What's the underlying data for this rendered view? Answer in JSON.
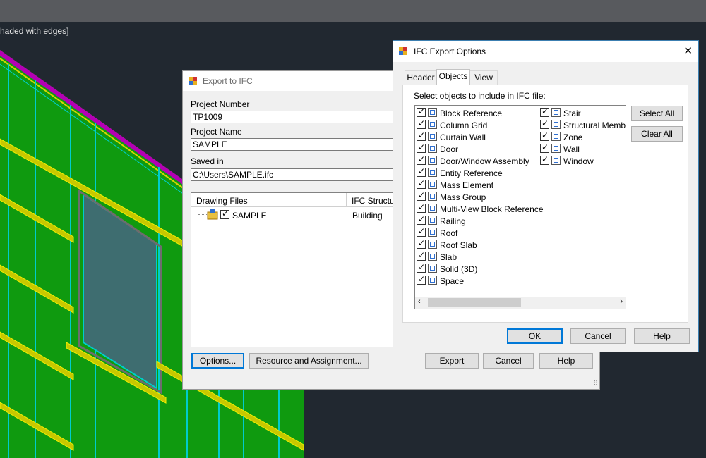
{
  "viewport": {
    "label": "haded with edges]"
  },
  "export_dialog": {
    "title": "Export to IFC",
    "project_number_label": "Project Number",
    "project_number_value": "TP1009",
    "project_name_label": "Project Name",
    "project_name_value": "SAMPLE",
    "saved_in_label": "Saved in",
    "saved_in_value": "C:\\Users\\SAMPLE.ifc",
    "columns": [
      "Drawing Files",
      "IFC Structur"
    ],
    "rows": [
      {
        "name": "SAMPLE",
        "structure": "Building"
      }
    ],
    "buttons": {
      "options": "Options...",
      "resource": "Resource and Assignment...",
      "export": "Export",
      "cancel": "Cancel",
      "help": "Help"
    }
  },
  "options_dialog": {
    "title": "IFC Export Options",
    "close_glyph": "✕",
    "tabs": [
      "Header",
      "Objects",
      "View"
    ],
    "active_tab": "Objects",
    "instruction": "Select objects to include in IFC file:",
    "objects_col1": [
      {
        "label": "Block Reference",
        "icon": "block-reference-icon"
      },
      {
        "label": "Column Grid",
        "icon": "column-grid-icon"
      },
      {
        "label": "Curtain Wall",
        "icon": "curtain-wall-icon"
      },
      {
        "label": "Door",
        "icon": "door-icon"
      },
      {
        "label": "Door/Window Assembly",
        "icon": "door-window-assembly-icon"
      },
      {
        "label": "Entity Reference",
        "icon": "entity-reference-icon"
      },
      {
        "label": "Mass Element",
        "icon": "mass-element-icon"
      },
      {
        "label": "Mass Group",
        "icon": "mass-group-icon"
      },
      {
        "label": "Multi-View Block Reference",
        "icon": "multi-view-block-icon"
      },
      {
        "label": "Railing",
        "icon": "railing-icon"
      },
      {
        "label": "Roof",
        "icon": "roof-icon"
      },
      {
        "label": "Roof Slab",
        "icon": "roof-slab-icon"
      },
      {
        "label": "Slab",
        "icon": "slab-icon"
      },
      {
        "label": "Solid (3D)",
        "icon": "solid-3d-icon"
      },
      {
        "label": "Space",
        "icon": "space-icon"
      }
    ],
    "objects_col2": [
      {
        "label": "Stair",
        "icon": "stair-icon"
      },
      {
        "label": "Structural Member",
        "icon": "structural-member-icon"
      },
      {
        "label": "Zone",
        "icon": "zone-icon"
      },
      {
        "label": "Wall",
        "icon": "wall-icon"
      },
      {
        "label": "Window",
        "icon": "window-icon"
      }
    ],
    "select_all": "Select All",
    "clear_all": "Clear All",
    "ok": "OK",
    "cancel": "Cancel",
    "help": "Help"
  }
}
